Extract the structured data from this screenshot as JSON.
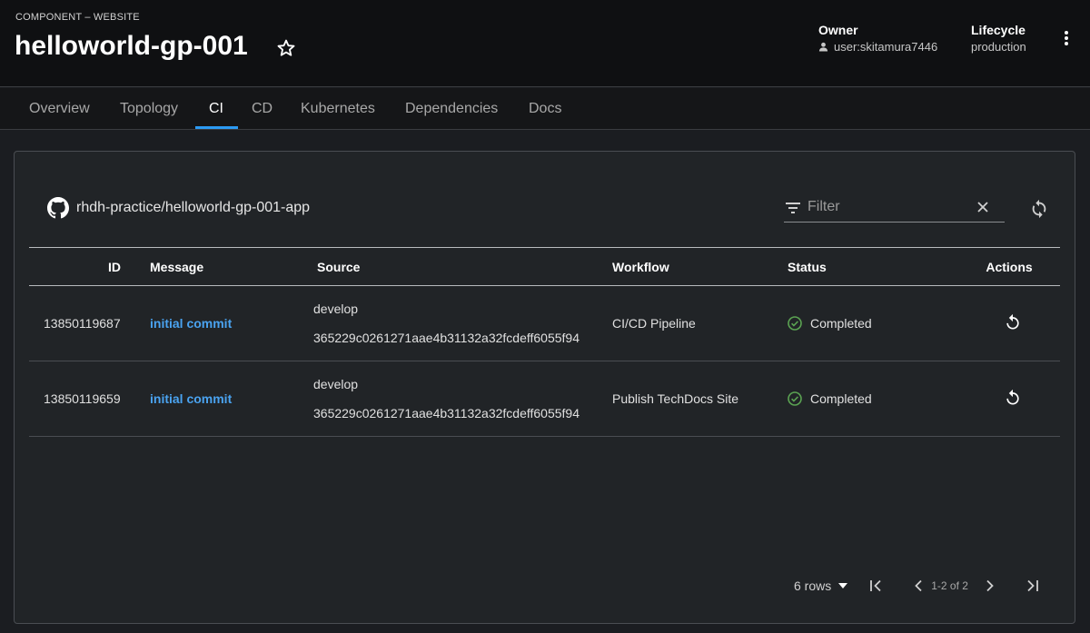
{
  "header": {
    "kind": "COMPONENT – WEBSITE",
    "title": "helloworld-gp-001",
    "owner_label": "Owner",
    "owner_value": "user:skitamura7446",
    "lifecycle_label": "Lifecycle",
    "lifecycle_value": "production"
  },
  "tabs": [
    {
      "label": "Overview"
    },
    {
      "label": "Topology"
    },
    {
      "label": "CI",
      "active": true
    },
    {
      "label": "CD"
    },
    {
      "label": "Kubernetes"
    },
    {
      "label": "Dependencies"
    },
    {
      "label": "Docs"
    }
  ],
  "ci": {
    "repo": "rhdh-practice/helloworld-gp-001-app",
    "filter_placeholder": "Filter",
    "columns": {
      "id": "ID",
      "message": "Message",
      "source": "Source",
      "workflow": "Workflow",
      "status": "Status",
      "actions": "Actions"
    },
    "rows": [
      {
        "id": "13850119687",
        "message": "initial commit",
        "branch": "develop",
        "sha": "365229c0261271aae4b31132a32fcdeff6055f94",
        "workflow": "CI/CD Pipeline",
        "status": "Completed"
      },
      {
        "id": "13850119659",
        "message": "initial commit",
        "branch": "develop",
        "sha": "365229c0261271aae4b31132a32fcdeff6055f94",
        "workflow": "Publish TechDocs Site",
        "status": "Completed"
      }
    ],
    "pagination": {
      "rows_per_page": "6 rows",
      "range": "1-2 of 2"
    }
  },
  "colors": {
    "accent": "#2b9af3",
    "link": "#4aa3f0",
    "success": "#5ba352"
  },
  "icons": [
    "star-icon",
    "user-icon",
    "kebab-icon",
    "github-icon",
    "filter-icon",
    "clear-icon",
    "refresh-icon",
    "check-circle-icon",
    "rerun-icon",
    "caret-down-icon",
    "first-page-icon",
    "prev-page-icon",
    "next-page-icon",
    "last-page-icon"
  ]
}
